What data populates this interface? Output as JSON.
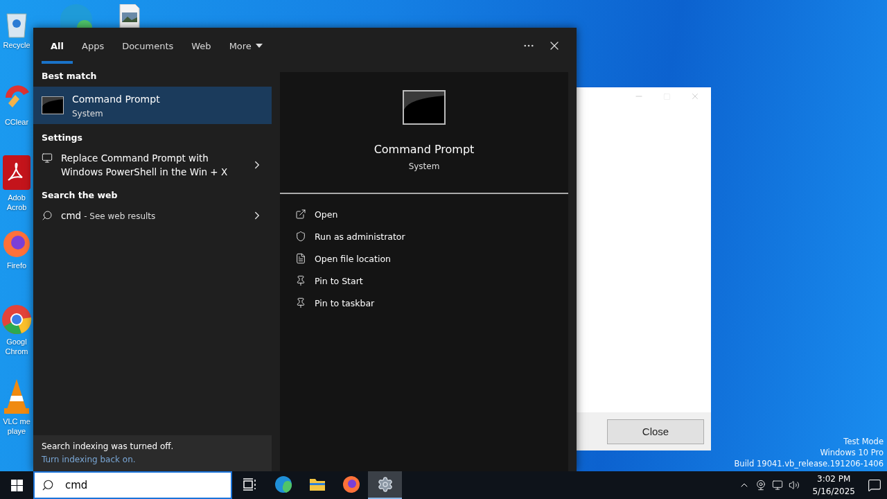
{
  "desktop": {
    "icons": [
      {
        "kind": "recycle",
        "label": "Recycle"
      },
      {
        "kind": "ccleaner",
        "label": "CClear"
      },
      {
        "kind": "acrobat",
        "label": "Adob Acrob"
      },
      {
        "kind": "firefox",
        "label": "Firefo"
      },
      {
        "kind": "chrome",
        "label": "Googl Chrom"
      },
      {
        "kind": "vlc",
        "label": "VLC me playe"
      }
    ],
    "top_icons": [
      {
        "kind": "edge"
      },
      {
        "kind": "image"
      }
    ],
    "watermark": [
      "Test Mode",
      "Windows 10 Pro",
      "Build 19041.vb_release.191206-1406"
    ]
  },
  "dialog": {
    "button": "Close"
  },
  "search_panel": {
    "tabs": [
      {
        "label": "All",
        "selected": true,
        "dropdown": false
      },
      {
        "label": "Apps",
        "selected": false,
        "dropdown": false
      },
      {
        "label": "Documents",
        "selected": false,
        "dropdown": false
      },
      {
        "label": "Web",
        "selected": false,
        "dropdown": false
      },
      {
        "label": "More",
        "selected": false,
        "dropdown": true
      }
    ],
    "sections": [
      {
        "heading": "Best match",
        "items": [
          {
            "kind": "app",
            "title": "Command Prompt",
            "subtitle": "System",
            "selected": true
          }
        ]
      },
      {
        "heading": "Settings",
        "items": [
          {
            "kind": "setting",
            "title": "Replace Command Prompt with Windows PowerShell in the Win + X",
            "selected": false
          }
        ]
      },
      {
        "heading": "Search the web",
        "items": [
          {
            "kind": "web",
            "title": "cmd",
            "subtitle": "- See web results",
            "selected": false
          }
        ]
      }
    ],
    "notice": {
      "text": "Search indexing was turned off.",
      "link": "Turn indexing back on."
    },
    "preview": {
      "title": "Command Prompt",
      "subtitle": "System",
      "actions": [
        {
          "kind": "open",
          "label": "Open"
        },
        {
          "kind": "admin",
          "label": "Run as administrator"
        },
        {
          "kind": "location",
          "label": "Open file location"
        },
        {
          "kind": "pin",
          "label": "Pin to Start"
        },
        {
          "kind": "pin",
          "label": "Pin to taskbar"
        }
      ]
    }
  },
  "taskbar": {
    "search": {
      "value": "cmd"
    },
    "apps": [
      {
        "kind": "taskview",
        "active": false
      },
      {
        "kind": "edge",
        "active": false
      },
      {
        "kind": "explorer",
        "active": false
      },
      {
        "kind": "firefox",
        "active": false
      },
      {
        "kind": "settings",
        "active": true
      }
    ],
    "time": "3:02 PM",
    "date": "5/16/2025"
  }
}
